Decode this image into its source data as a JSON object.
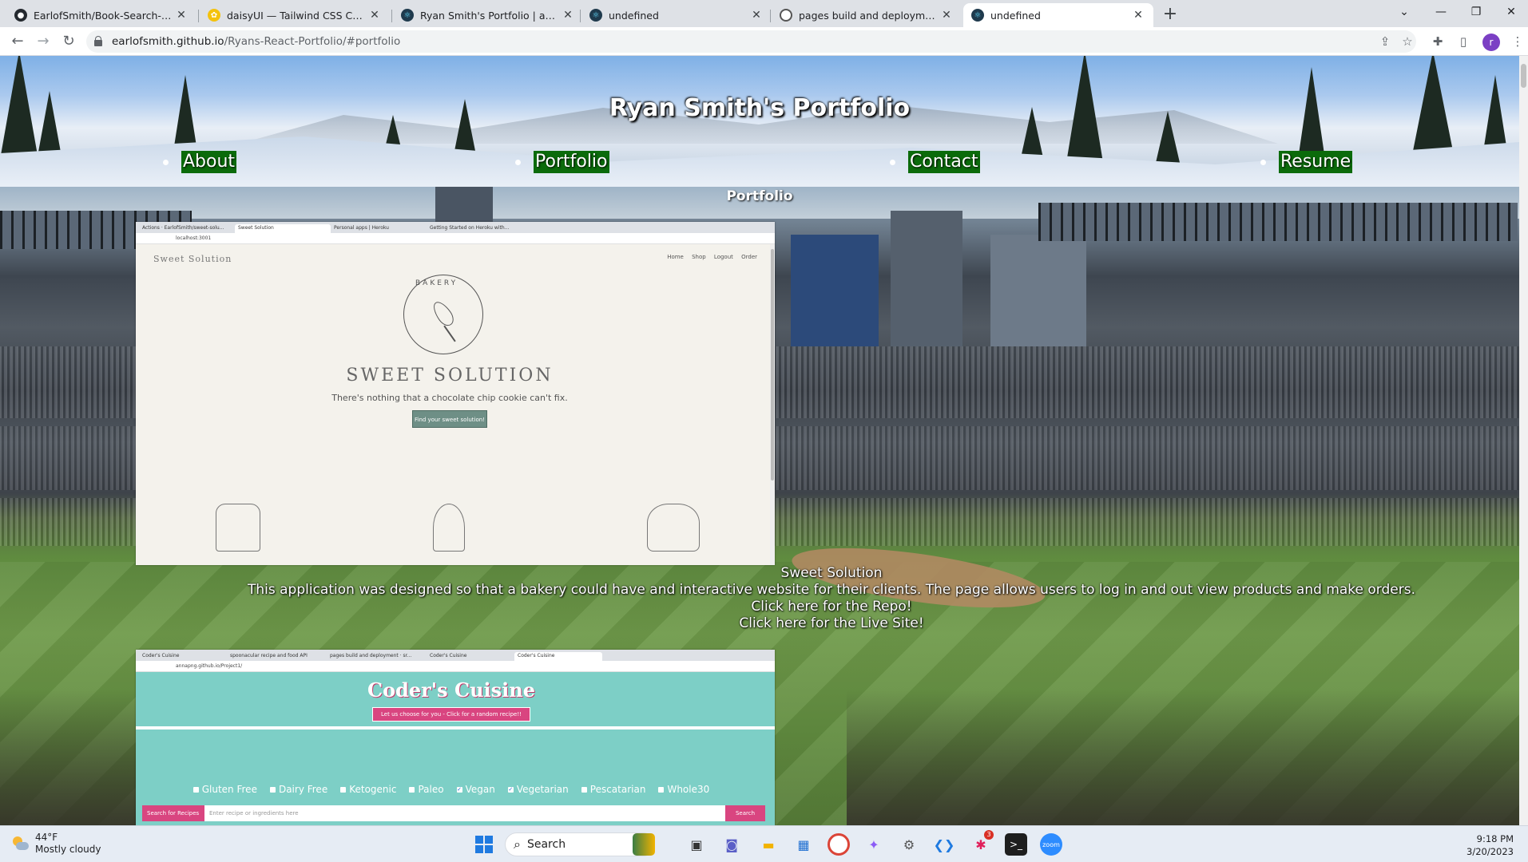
{
  "browser": {
    "tabs": [
      {
        "title": "EarlofSmith/Book-Search-Engine",
        "icon": "github-icon",
        "active": false
      },
      {
        "title": "daisyUI — Tailwind CSS Components",
        "icon": "daisyui-icon",
        "active": false
      },
      {
        "title": "Ryan Smith's Portfolio | about",
        "icon": "react-icon",
        "active": false
      },
      {
        "title": "undefined",
        "icon": "react-icon",
        "active": false
      },
      {
        "title": "pages build and deployment · EarlofSmith",
        "icon": "github-icon",
        "active": false
      },
      {
        "title": "undefined",
        "icon": "react-icon",
        "active": true
      }
    ],
    "url_host": "earlofsmith.github.io",
    "url_path": "/Ryans-React-Portfolio/#portfolio",
    "profile_initial": "r"
  },
  "site": {
    "title": "Ryan Smith's Portfolio",
    "nav": [
      "About",
      "Portfolio",
      "Contact",
      "Resume"
    ],
    "section_heading": "Portfolio",
    "nav_bg": "#0b6b0b"
  },
  "projects": [
    {
      "name": "Sweet Solution",
      "description": "This application was designed so that a bakery could have and interactive website for their clients. The page allows users to log in and out view products and make orders.",
      "repo_link": "Click here for the Repo!",
      "live_link": "Click here for the Live Site!",
      "screenshot": {
        "tabs": [
          "Actions · EarlofSmith/sweet-solu...",
          "Sweet Solution",
          "Personal apps | Heroku",
          "Getting Started on Heroku with..."
        ],
        "url": "localhost:3001",
        "brand": "Sweet Solution",
        "nav": "Home Shop Logout Order",
        "logo_text": "BAKERY",
        "heading": "SWEET SOLUTION",
        "tagline": "There's nothing that a chocolate chip cookie can't fix.",
        "button": "Find your sweet solution!"
      }
    },
    {
      "name": "Coder's Cuisine",
      "screenshot": {
        "tabs": [
          "Coder's Cuisine",
          "spoonacular recipe and food API",
          "pages build and deployment · sr...",
          "Coder's Cuisine",
          "Coder's Cuisine"
        ],
        "url": "annapng.github.io/Project1/",
        "heading": "Coder's Cuisine",
        "random_button": "Let us choose for you - Click for a random recipe!!",
        "filters": [
          "Gluten Free",
          "Dairy Free",
          "Ketogenic",
          "Paleo",
          "Vegan",
          "Vegetarian",
          "Pescatarian",
          "Whole30"
        ],
        "checked": [
          "Vegan",
          "Vegetarian"
        ],
        "search_label": "Search for Recipes",
        "search_placeholder": "Enter recipe or ingredients here",
        "search_button": "Search"
      }
    }
  ],
  "taskbar": {
    "temperature": "44°F",
    "weather": "Mostly cloudy",
    "search_label": "Search",
    "time": "9:18 PM",
    "date": "3/20/2023",
    "badge_count": "3"
  }
}
